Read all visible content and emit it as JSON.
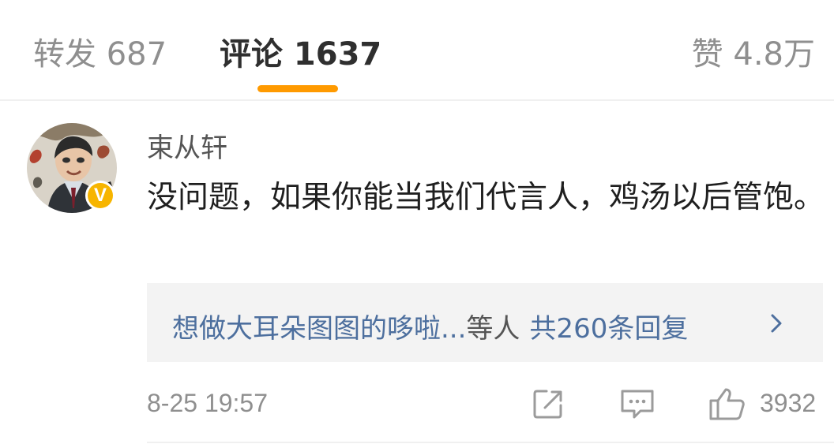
{
  "tabs": {
    "repost": "转发 687",
    "comments": "评论 1637",
    "likes": "赞 4.8万"
  },
  "accent_color": "#ff9a00",
  "comment": {
    "username": "束从轩",
    "verified_badge": "V",
    "text": "没问题，如果你能当我们代言人，鸡汤以后管饱。",
    "replies": {
      "users": "想做大耳朵图图的哆啦...",
      "suffix": "等人",
      "count": "共260条回复"
    },
    "timestamp": "8-25 19:57",
    "like_count": "3932"
  },
  "icons": {
    "share": "share-icon",
    "comment": "comment-icon",
    "like": "like-icon",
    "chevron": "chevron-right-icon",
    "verified": "verified-badge-icon"
  }
}
